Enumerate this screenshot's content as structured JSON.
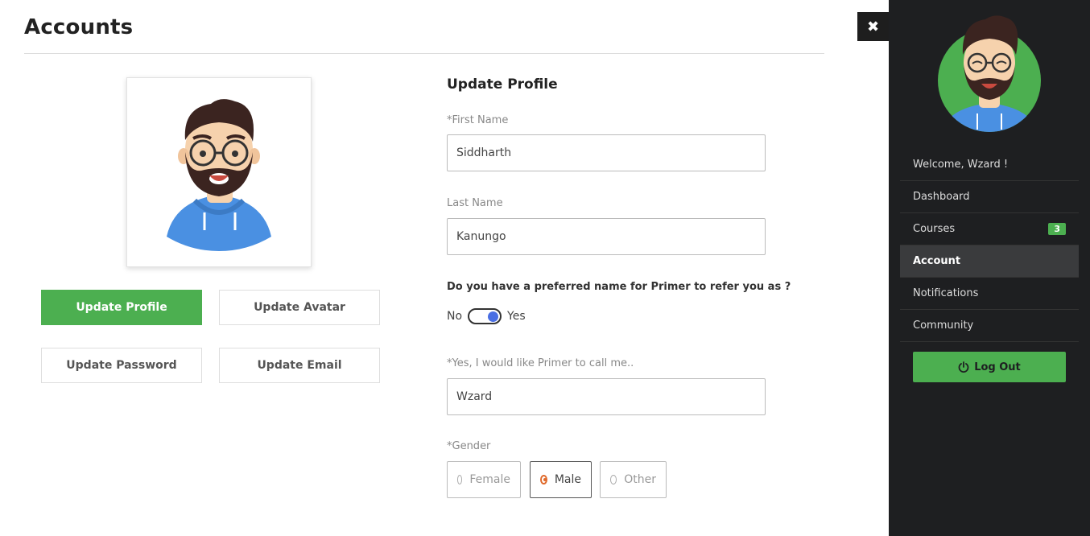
{
  "page": {
    "title": "Accounts"
  },
  "actions": {
    "update_profile": "Update Profile",
    "update_avatar": "Update Avatar",
    "update_password": "Update Password",
    "update_email": "Update Email"
  },
  "form": {
    "title": "Update Profile",
    "first_name": {
      "label": "*First Name",
      "value": "Siddharth"
    },
    "last_name": {
      "label": "Last Name",
      "value": "Kanungo"
    },
    "preferred_question": "Do you have a preferred name for Primer to refer you as ?",
    "toggle": {
      "off_label": "No",
      "on_label": "Yes",
      "state": true
    },
    "preferred_name": {
      "label": "*Yes, I would like Primer to call me..",
      "value": "Wzard"
    },
    "gender": {
      "label": "*Gender",
      "options": [
        "Female",
        "Male",
        "Other"
      ],
      "selected": "Male"
    }
  },
  "sidebar": {
    "close_icon": "close-icon",
    "welcome": "Welcome, Wzard !",
    "items": [
      {
        "label": "Dashboard"
      },
      {
        "label": "Courses",
        "badge": "3"
      },
      {
        "label": "Account",
        "active": true
      },
      {
        "label": "Notifications"
      },
      {
        "label": "Community"
      }
    ],
    "logout_label": "Log Out"
  },
  "colors": {
    "accent_green": "#4caf50",
    "sidebar_bg": "#1e1f21",
    "toggle_blue": "#4a6fe3",
    "radio_orange": "#e06a2c"
  }
}
